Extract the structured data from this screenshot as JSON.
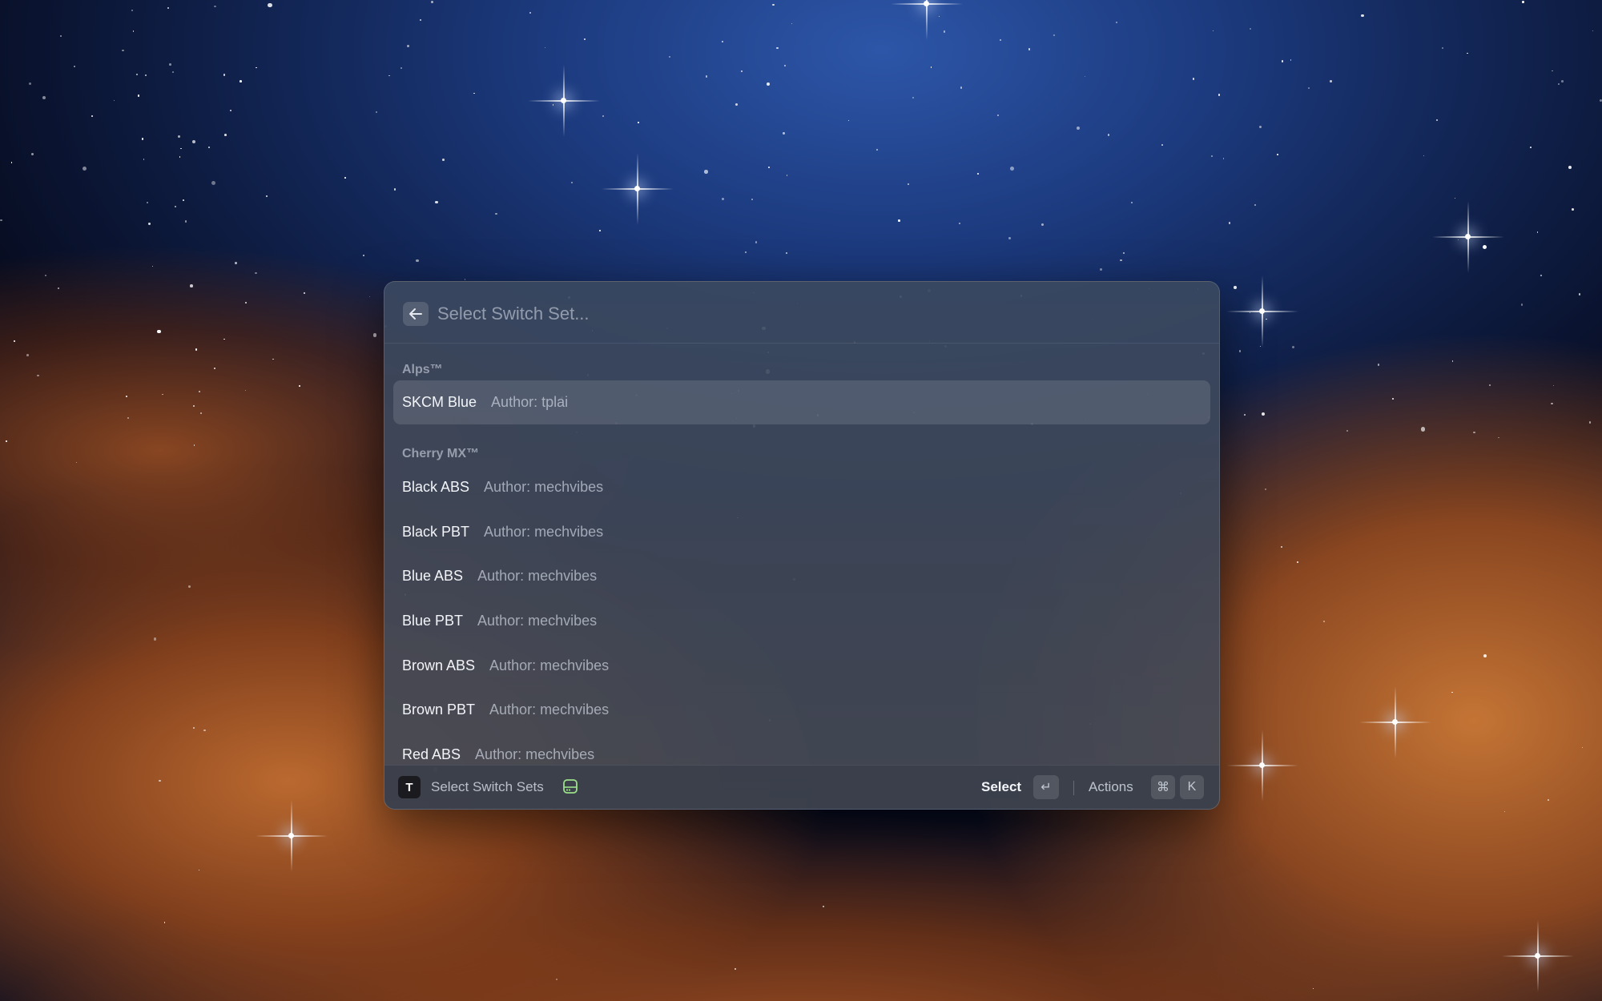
{
  "search": {
    "placeholder": "Select Switch Set...",
    "value": ""
  },
  "sections": [
    {
      "title": "Alps™",
      "items": [
        {
          "title": "SKCM Blue",
          "subtitle": "Author: tplai",
          "selected": true
        }
      ]
    },
    {
      "title": "Cherry MX™",
      "items": [
        {
          "title": "Black ABS",
          "subtitle": "Author: mechvibes"
        },
        {
          "title": "Black PBT",
          "subtitle": "Author: mechvibes"
        },
        {
          "title": "Blue ABS",
          "subtitle": "Author: mechvibes"
        },
        {
          "title": "Blue PBT",
          "subtitle": "Author: mechvibes"
        },
        {
          "title": "Brown ABS",
          "subtitle": "Author: mechvibes"
        },
        {
          "title": "Brown PBT",
          "subtitle": "Author: mechvibes"
        },
        {
          "title": "Red ABS",
          "subtitle": "Author: mechvibes"
        }
      ]
    }
  ],
  "footer": {
    "app_icon_letter": "T",
    "title": "Select Switch Sets",
    "primary_action": "Select",
    "enter_key": "↵",
    "actions_label": "Actions",
    "cmd_key": "⌘",
    "k_key": "K"
  },
  "icons": {
    "back": "arrow-left-icon",
    "command_icon": "hard-drive-icon"
  },
  "colors": {
    "command_icon_accent": "#9be08a"
  }
}
